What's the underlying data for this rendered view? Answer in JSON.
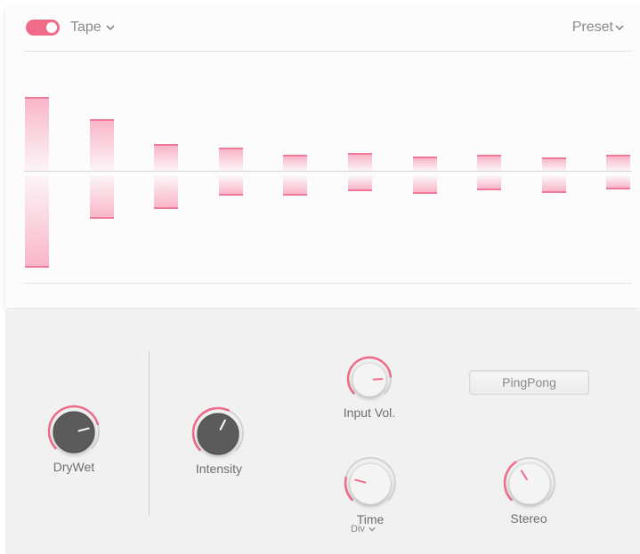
{
  "header": {
    "enabled": true,
    "mode_label": "Tape",
    "preset_label": "Preset"
  },
  "colors": {
    "accent": "#f06a8a",
    "knob_dark": "#5b5b5b",
    "knob_light": "#f4f4f4"
  },
  "taps": [
    {
      "up": 1.0,
      "down": 1.0
    },
    {
      "up": 0.69,
      "down": 0.46
    },
    {
      "up": 0.35,
      "down": 0.35
    },
    {
      "up": 0.3,
      "down": 0.2
    },
    {
      "up": 0.2,
      "down": 0.2
    },
    {
      "up": 0.22,
      "down": 0.15
    },
    {
      "up": 0.17,
      "down": 0.18
    },
    {
      "up": 0.2,
      "down": 0.14
    },
    {
      "up": 0.16,
      "down": 0.17
    },
    {
      "up": 0.2,
      "down": 0.13
    }
  ],
  "controls": {
    "drywet": {
      "label": "DryWet",
      "value": 0.78
    },
    "intensity": {
      "label": "Intensity",
      "value": 0.6
    },
    "input_vol": {
      "label": "Input Vol.",
      "value": 0.82
    },
    "time": {
      "label": "Time",
      "value": 0.22,
      "sub_label": "Div"
    },
    "stereo": {
      "label": "Stereo",
      "value": 0.38
    }
  },
  "pingpong_label": "PingPong"
}
